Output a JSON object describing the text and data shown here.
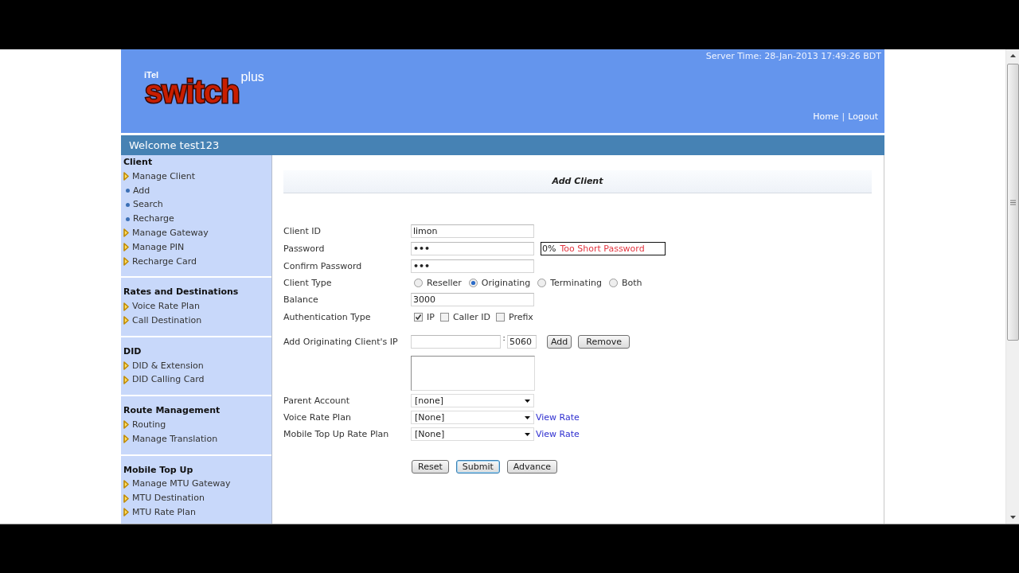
{
  "header": {
    "logo": {
      "prefix": "iTel",
      "name": "switch",
      "suffix": "plus"
    },
    "server_time": "Server Time: 28-Jan-2013 17:49:26 BDT",
    "links": [
      "Home",
      "Logout"
    ],
    "link_separator": "|"
  },
  "welcome": "Welcome test123",
  "sidebar": {
    "sections": [
      {
        "title": "Client",
        "items": [
          {
            "label": "Manage Client",
            "children": [
              {
                "label": "Add"
              },
              {
                "label": "Search"
              },
              {
                "label": "Recharge"
              }
            ]
          },
          {
            "label": "Manage Gateway"
          },
          {
            "label": "Manage PIN"
          },
          {
            "label": "Recharge Card"
          }
        ]
      },
      {
        "title": "Rates and Destinations",
        "items": [
          {
            "label": "Voice Rate Plan"
          },
          {
            "label": "Call Destination"
          }
        ]
      },
      {
        "title": "DID",
        "items": [
          {
            "label": "DID & Extension"
          },
          {
            "label": "DID Calling Card"
          }
        ]
      },
      {
        "title": "Route Management",
        "items": [
          {
            "label": "Routing"
          },
          {
            "label": "Manage Translation"
          }
        ]
      },
      {
        "title": "Mobile Top Up",
        "items": [
          {
            "label": "Manage MTU Gateway"
          },
          {
            "label": "MTU Destination"
          },
          {
            "label": "MTU Rate Plan"
          }
        ]
      }
    ]
  },
  "form": {
    "title": "Add Client",
    "fields": [
      {
        "kind": "text",
        "label": "Client ID",
        "value": "limon"
      },
      {
        "kind": "password",
        "label": "Password",
        "value": "•••",
        "strength": {
          "percent": "0%",
          "message": "Too Short Password"
        }
      },
      {
        "kind": "password",
        "label": "Confirm Password",
        "value": "•••"
      },
      {
        "kind": "radio",
        "label": "Client Type",
        "options": [
          {
            "label": "Reseller",
            "selected": false
          },
          {
            "label": "Originating",
            "selected": true
          },
          {
            "label": "Terminating",
            "selected": false
          },
          {
            "label": "Both",
            "selected": false
          }
        ]
      },
      {
        "kind": "text",
        "label": "Balance",
        "value": "3000"
      },
      {
        "kind": "checkbox",
        "label": "Authentication Type",
        "options": [
          {
            "label": "IP",
            "checked": true
          },
          {
            "label": "Caller ID",
            "checked": false
          },
          {
            "label": "Prefix",
            "checked": false
          }
        ]
      },
      {
        "kind": "ip",
        "label": "Add Originating Client's IP",
        "separator": ":",
        "port": "5060",
        "buttons": [
          "Add",
          "Remove"
        ]
      },
      {
        "kind": "listbox"
      },
      {
        "kind": "select",
        "label": "Parent Account",
        "value": "[none]"
      },
      {
        "kind": "select",
        "label": "Voice Rate Plan",
        "value": "[None]",
        "link": "View Rate"
      },
      {
        "kind": "select",
        "label": "Mobile Top Up Rate Plan",
        "value": "[None]",
        "link": "View Rate"
      }
    ],
    "buttons": [
      {
        "label": "Reset",
        "focused": false
      },
      {
        "label": "Submit",
        "focused": true
      },
      {
        "label": "Advance",
        "focused": false
      }
    ]
  }
}
